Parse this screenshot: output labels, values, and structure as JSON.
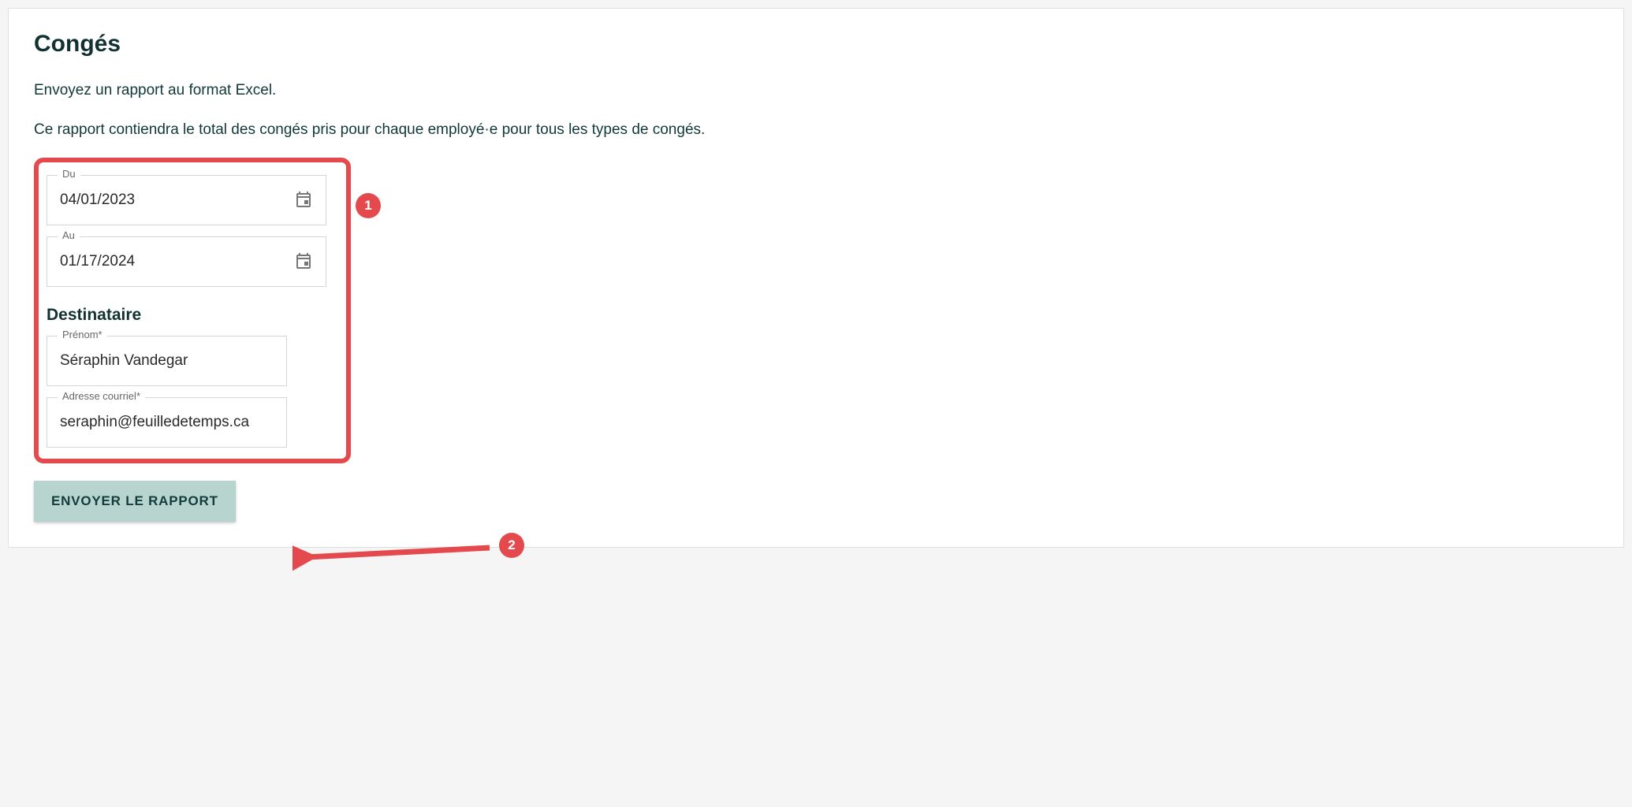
{
  "title": "Congés",
  "desc1": "Envoyez un rapport au format Excel.",
  "desc2": "Ce rapport contiendra le total des congés pris pour chaque employé·e pour tous les types de congés.",
  "labels": {
    "from": "Du",
    "to": "Au",
    "recipient_heading": "Destinataire",
    "firstname": "Prénom",
    "email": "Adresse courriel",
    "required": "*"
  },
  "values": {
    "from": "04/01/2023",
    "to": "01/17/2024",
    "firstname": "Séraphin Vandegar",
    "email": "seraphin@feuilledetemps.ca"
  },
  "button": "ENVOYER LE RAPPORT",
  "annotations": {
    "badge1": "1",
    "badge2": "2"
  }
}
